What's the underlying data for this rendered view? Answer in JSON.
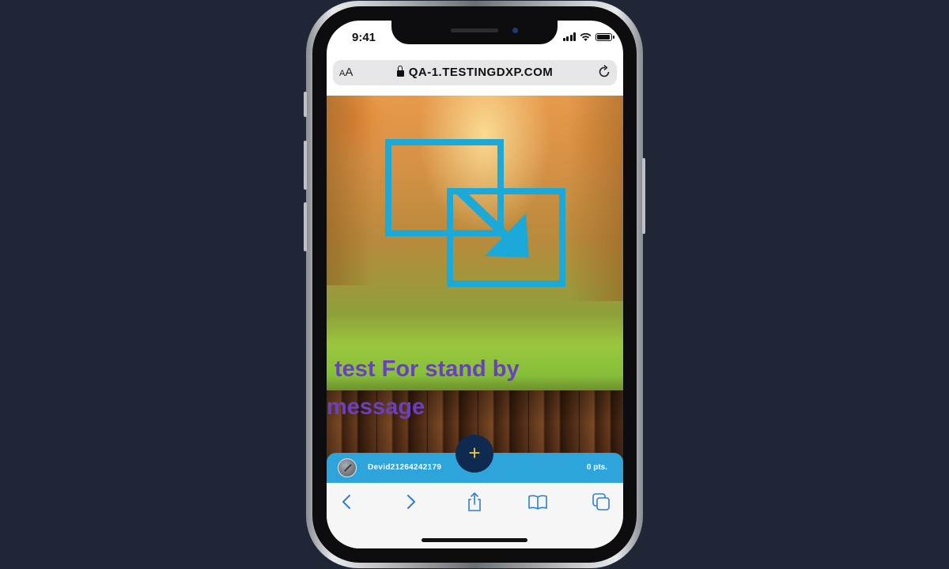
{
  "status_bar": {
    "time": "9:41"
  },
  "browser": {
    "text_size_label_small": "A",
    "text_size_label_large": "A",
    "url": "QA-1.TESTINGDXP.COM"
  },
  "content": {
    "standby_line1": "test For stand by",
    "standby_line2": "message"
  },
  "bottom_bar": {
    "username": "Devid21264242179",
    "points": "0 pts.",
    "add_label": "+"
  },
  "colors": {
    "background": "#212637",
    "accent_bar": "#2ea5da",
    "add_button": "#0e2a4f",
    "standby_text": "#6a3fc0",
    "media_icon": "#1aa9d8"
  },
  "icons": [
    "lock-icon",
    "reload-icon",
    "media-placeholder-icon",
    "back-icon",
    "forward-icon",
    "share-icon",
    "bookmarks-icon",
    "tabs-icon"
  ]
}
